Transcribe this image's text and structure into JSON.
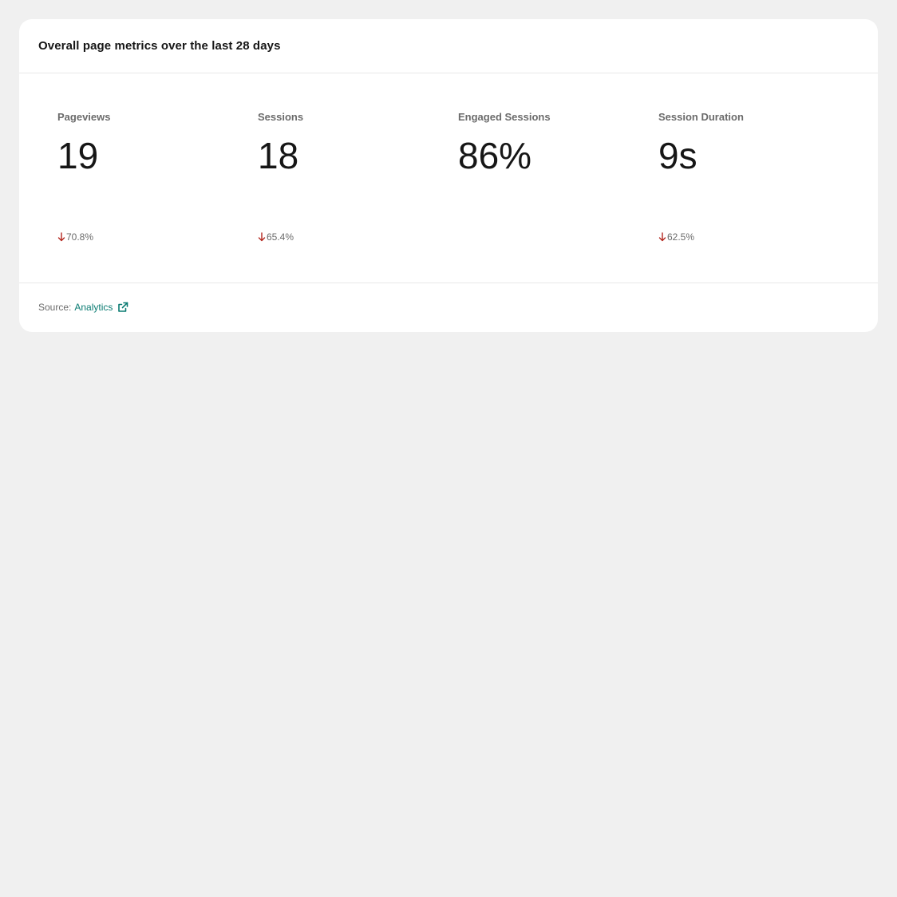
{
  "card": {
    "title": "Overall page metrics over the last 28 days"
  },
  "metrics": [
    {
      "label": "Pageviews",
      "value": "19",
      "change": "70.8%",
      "trend": "down",
      "icon": "arrow-down-icon"
    },
    {
      "label": "Sessions",
      "value": "18",
      "change": "65.4%",
      "trend": "down",
      "icon": "arrow-down-icon"
    },
    {
      "label": "Engaged Sessions",
      "value": "86%",
      "change": "",
      "trend": "",
      "icon": ""
    },
    {
      "label": "Session Duration",
      "value": "9s",
      "change": "62.5%",
      "trend": "down",
      "icon": "arrow-down-icon"
    }
  ],
  "footer": {
    "source_label": "Source:",
    "source_link": "Analytics",
    "source_icon": "external-link-icon"
  },
  "colors": {
    "page_background": "#f0f0f0",
    "card_background": "#ffffff",
    "link": "#0a7b72",
    "trend_down": "#b3261e"
  }
}
